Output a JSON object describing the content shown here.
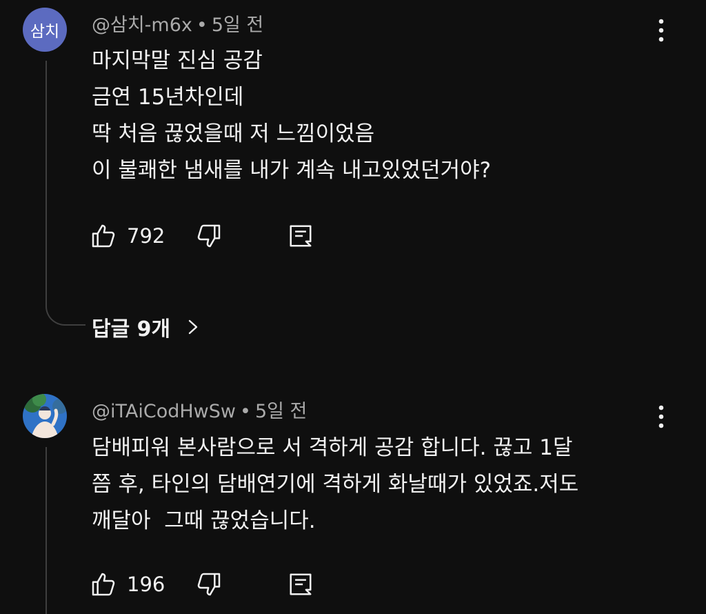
{
  "comments": [
    {
      "avatar_text": "삼치",
      "author": "@삼치-m6x",
      "separator": "•",
      "time": "5일 전",
      "lines": [
        "마지막말 진심 공감",
        "금연 15년차인데",
        "딱 처음 끊었을때 저 느낌이었음",
        "이 불쾌한 냄새를 내가 계속 내고있었던거야?"
      ],
      "likes": "792",
      "replies_label": "답글 9개"
    },
    {
      "author": "@iTAiCodHwSw",
      "separator": "•",
      "time": "5일 전",
      "lines": [
        "담배피워 본사람으로 서 격하게 공감 합니다. 끊고 1달",
        "쯤 후, 타인의 담배연기에 격하게 화날때가 있었죠.저도",
        "깨달아  그때 끊었습니다."
      ],
      "likes": "196"
    }
  ],
  "colors": {
    "background": "#0f0f0f",
    "text": "#f1f1f1",
    "meta": "#aaaaaa",
    "avatar1": "#5c6bc0",
    "avatar2": "#2f72c6"
  },
  "icons": [
    "like-icon",
    "dislike-icon",
    "reply-icon",
    "more-vert-icon",
    "chevron-right-icon"
  ]
}
